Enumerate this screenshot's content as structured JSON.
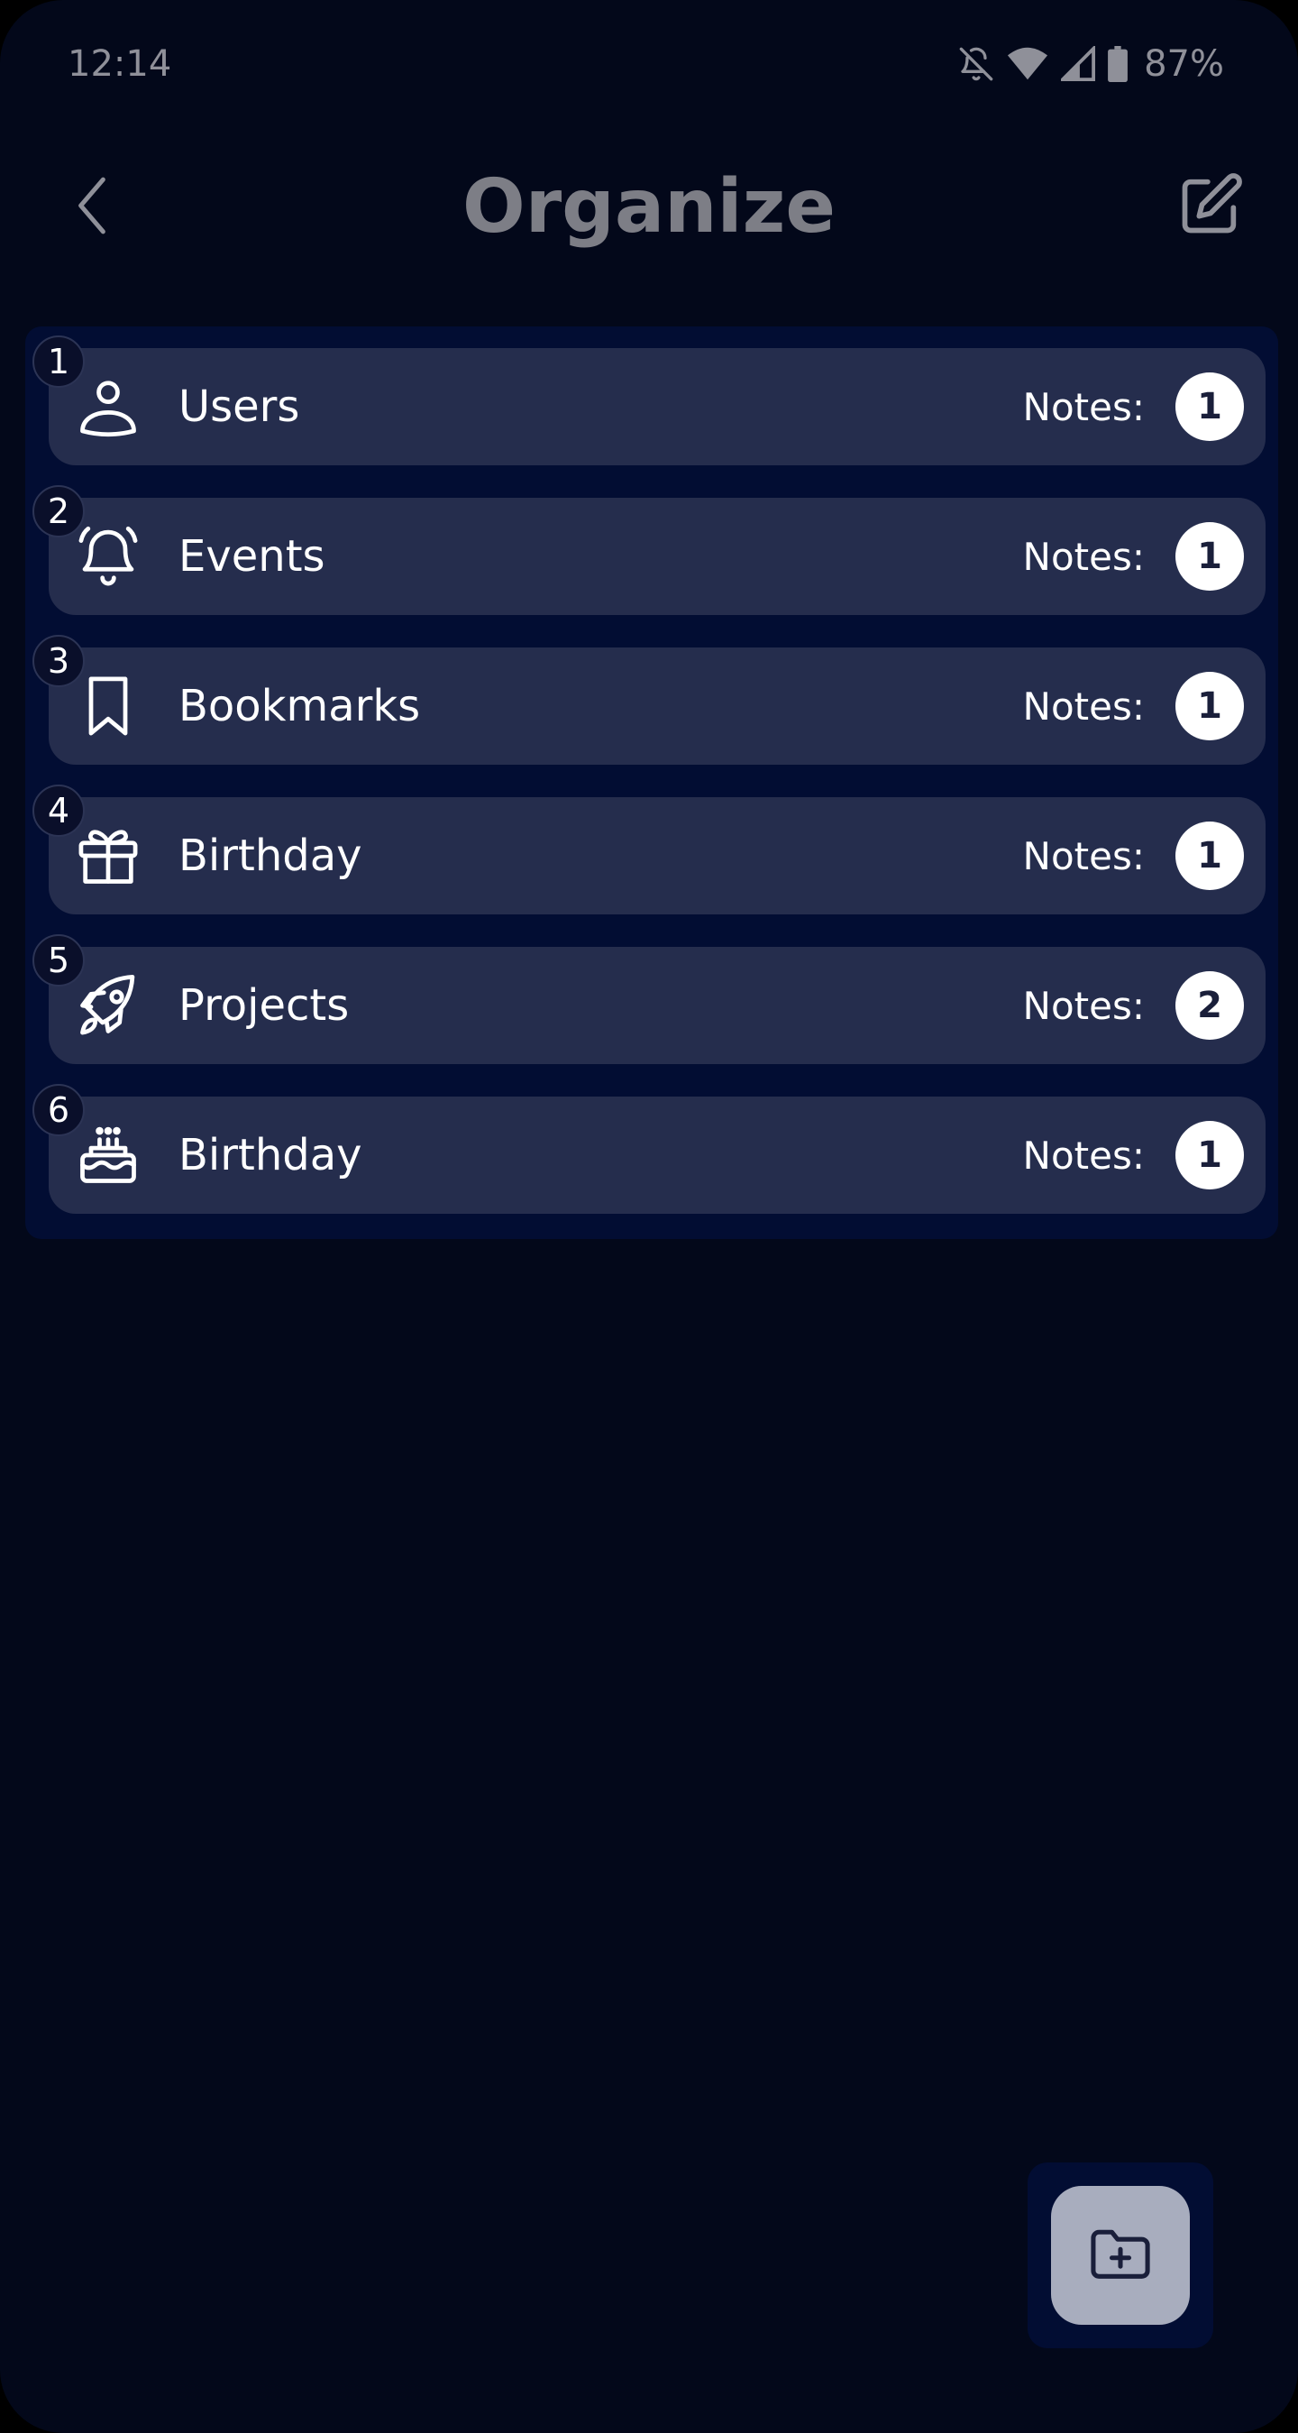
{
  "status_bar": {
    "time": "12:14",
    "battery": "87%",
    "icons": [
      "notifications-off-icon",
      "wifi-icon",
      "signal-icon",
      "battery-icon"
    ]
  },
  "header": {
    "title": "Organize",
    "back_icon": "chevron-left-icon",
    "edit_icon": "edit-icon"
  },
  "categories": [
    {
      "number": "1",
      "label": "Users",
      "icon": "user-icon",
      "notes_label": "Notes:",
      "notes_count": "1"
    },
    {
      "number": "2",
      "label": "Events",
      "icon": "bell-icon",
      "notes_label": "Notes:",
      "notes_count": "1"
    },
    {
      "number": "3",
      "label": "Bookmarks",
      "icon": "bookmark-icon",
      "notes_label": "Notes:",
      "notes_count": "1"
    },
    {
      "number": "4",
      "label": "Birthday",
      "icon": "gift-icon",
      "notes_label": "Notes:",
      "notes_count": "1"
    },
    {
      "number": "5",
      "label": "Projects",
      "icon": "rocket-icon",
      "notes_label": "Notes:",
      "notes_count": "2"
    },
    {
      "number": "6",
      "label": "Birthday",
      "icon": "cake-icon",
      "notes_label": "Notes:",
      "notes_count": "1"
    }
  ],
  "fab": {
    "icon": "folder-add-icon"
  },
  "colors": {
    "background": "#03081a",
    "list_background": "#020d33",
    "item_background": "#252d4d",
    "title": "#7d7e86",
    "badge": "#ffffff",
    "fab": "#a8adbe"
  }
}
